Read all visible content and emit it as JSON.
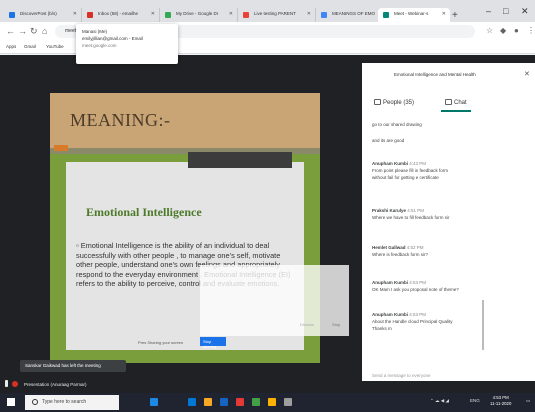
{
  "browser": {
    "tabs": [
      {
        "label": "DiscoverPost (b/s)",
        "color": "#1a73e8"
      },
      {
        "label": "Inbox (58) - emailhe",
        "color": "#d93025"
      },
      {
        "label": "My Drive - Google Dr",
        "color": "#34a853"
      },
      {
        "label": "Live testing PARENT",
        "color": "#ea4335"
      },
      {
        "label": "MEANINGS OF EMO",
        "color": "#4285f4"
      },
      {
        "label": "Meet - Webinar-s",
        "color": "#00897b"
      }
    ],
    "new_tab": "+",
    "window_controls": [
      "–",
      "□",
      "✕"
    ],
    "address": "meet.go",
    "bookmarks": [
      "Apps",
      "Gmail",
      "YouTube"
    ]
  },
  "account_popup": {
    "name": "Manasi (Me)",
    "email": "emilyjillian@gmail.com - Email",
    "extra": "meet.google.com"
  },
  "meet": {
    "header_text": "Emotional Intelligence and Mental Health",
    "slide": {
      "title": "MEANING:-",
      "subtitle": "Emotional Intelligence",
      "bullet": "Emotional Intelligence is the ability of an individual to deal successfully with other people , to manage one's self, motivate other people, understand one's own feelings and appropriately respond to the everyday environment . Emotional Intelligence (EI) refers to the ability to perceive, control and evaluate emotions."
    },
    "overlay_faint": "Dismiss",
    "overlay_link": "Stop",
    "share_bar": "Pres Sharing your screen",
    "share_button": "Stop sharing"
  },
  "chat": {
    "tabs": {
      "people": "People (35)",
      "chat": "Chat"
    },
    "messages": [
      {
        "sender": "",
        "time": "",
        "text": "go to our shared drawing"
      },
      {
        "sender": "",
        "time": "",
        "text": "and its are good"
      },
      {
        "sender": "Anupham Kumbi",
        "time": "4:43 PM",
        "text": "From point please fill in feedback form"
      },
      {
        "sender": "",
        "time": "",
        "text": "without fail for getting e certificate"
      },
      {
        "sender": "Prakshi Karulye",
        "time": "4:51 PM",
        "text": "Where we have to fill feedback form sir"
      },
      {
        "sender": "Hemlet Gallwad",
        "time": "4:52 PM",
        "text": "Where is feedback form sir?"
      },
      {
        "sender": "Anupham Kumbi",
        "time": "4:53 PM",
        "text": "OK Mam I ask you proposal note of theme?"
      },
      {
        "sender": "Anupham Kumbi",
        "time": "4:53 PM",
        "text": "About the Handle cloud Principal Quality"
      },
      {
        "sender": "",
        "time": "",
        "text": "Thanks m"
      }
    ],
    "input_placeholder": "Send a message to everyone"
  },
  "notices": {
    "toast": "Sanskar Gaikwad has left the meeting",
    "presenting": "Presentation (Anuraag Parmar)"
  },
  "taskbar": {
    "search": "Type here to search",
    "app_colors": [
      "#1e88e5",
      "#0078d4",
      "#f9a825",
      "#1565c0",
      "#e53935",
      "#43a047",
      "#ffb300"
    ],
    "tray": "ENG",
    "time": "4:53 PM",
    "date": "11-11-2020"
  }
}
